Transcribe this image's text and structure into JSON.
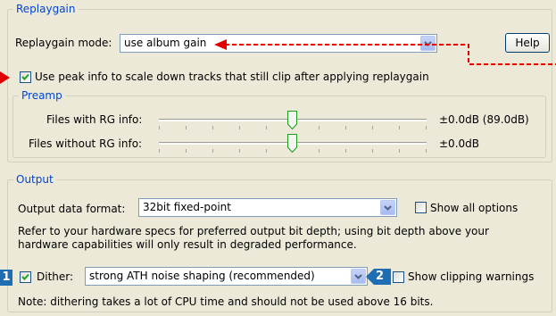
{
  "replaygain": {
    "legend": "Replaygain",
    "mode_label": "Replaygain mode:",
    "mode_value": "use album gain",
    "help_label": "Help",
    "peak_label": "Use peak info to scale down tracks that still clip after applying replaygain",
    "peak_checked": true
  },
  "preamp": {
    "legend": "Preamp",
    "with_label": "Files with RG info:",
    "with_value": "±0.0dB (89.0dB)",
    "with_level_db": 0.0,
    "without_label": "Files without RG info:",
    "without_value": "±0.0dB",
    "without_level_db": 0.0
  },
  "output": {
    "legend": "Output",
    "format_label": "Output data format:",
    "format_value": "32bit fixed-point",
    "show_all_label": "Show all options",
    "show_all_checked": false,
    "info_text": "Refer to your hardware specs for preferred output bit depth; using bit depth above your hardware capabilities will only result in degraded performance.",
    "dither_label": "Dither:",
    "dither_checked": true,
    "dither_value": "strong ATH noise shaping (recommended)",
    "clip_label": "Show clipping warnings",
    "clip_checked": false,
    "note_text": "Note: dithering takes a lot of CPU time and should not be used above 16 bits."
  },
  "annotations": {
    "badge1": "1",
    "badge2": "2",
    "arrow_color": "#e00000",
    "badge_color": "#1e6eb4"
  },
  "colors": {
    "background": "#ece9d8",
    "legend_text": "#0046d5",
    "border": "#d0d0bf"
  }
}
